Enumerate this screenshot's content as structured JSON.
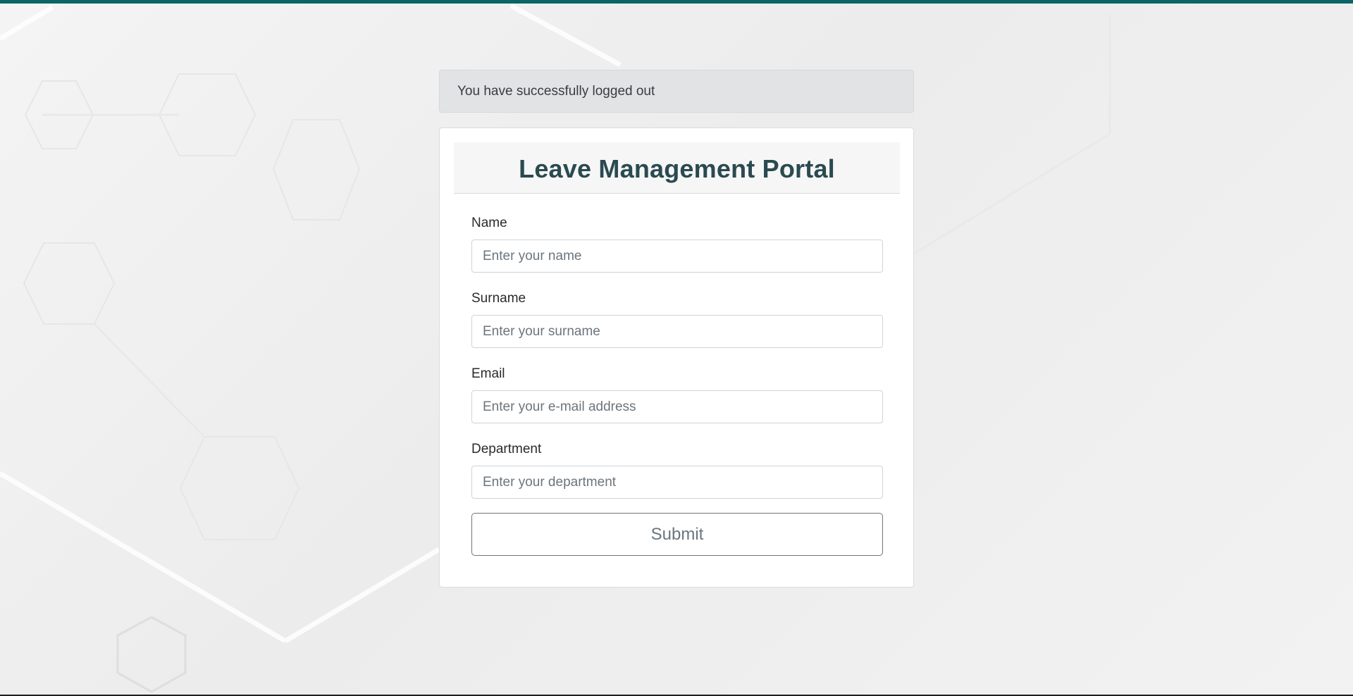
{
  "alert": {
    "message": "You have successfully logged out"
  },
  "form": {
    "title": "Leave Management Portal",
    "fields": [
      {
        "label": "Name",
        "placeholder": "Enter your name"
      },
      {
        "label": "Surname",
        "placeholder": "Enter your surname"
      },
      {
        "label": "Email",
        "placeholder": "Enter your e-mail address"
      },
      {
        "label": "Department",
        "placeholder": "Enter your department"
      }
    ],
    "submit_label": "Submit"
  },
  "colors": {
    "top_bar": "#0b6466",
    "title": "#2a4a50",
    "alert_background": "#e2e3e5",
    "button_outline": "#6c757d"
  }
}
